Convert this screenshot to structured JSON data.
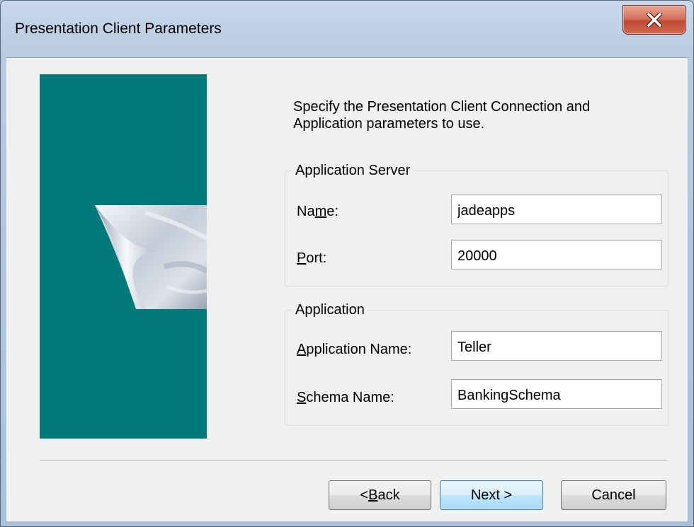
{
  "window": {
    "title": "Presentation Client Parameters"
  },
  "colors": {
    "art_background": "#007a78",
    "close_button": "#c7503a"
  },
  "intro": {
    "line1": "Specify the Presentation Client Connection and",
    "line2": "Application parameters to use."
  },
  "app_server": {
    "legend": "Application Server",
    "name_label_pre": "Na",
    "name_label_mnemonic": "m",
    "name_label_post": "e:",
    "name_value": "jadeapps",
    "port_label_pre": "",
    "port_label_mnemonic": "P",
    "port_label_post": "ort:",
    "port_value": "20000"
  },
  "application": {
    "legend": "Application",
    "app_name_label_pre": "",
    "app_name_label_mnemonic": "A",
    "app_name_label_post": "pplication Name:",
    "app_name_value": "Teller",
    "schema_label_pre": "",
    "schema_label_mnemonic": "S",
    "schema_label_post": "chema Name:",
    "schema_value": "BankingSchema"
  },
  "buttons": {
    "back_pre": "< ",
    "back_mnemonic": "B",
    "back_post": "ack",
    "next": "Next >",
    "cancel": "Cancel"
  }
}
